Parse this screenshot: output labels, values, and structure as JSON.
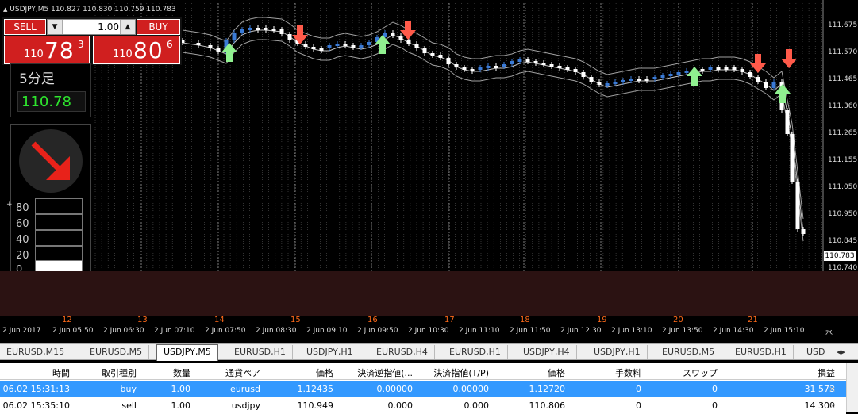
{
  "chart": {
    "header": "USDJPY,M5  110.827 110.830 110.759 110.783",
    "current_price": "110.783",
    "price_ticks": [
      "111.675",
      "111.570",
      "111.465",
      "111.360",
      "111.265",
      "111.155",
      "111.050",
      "110.950",
      "110.845",
      "110.740"
    ],
    "hour_labels": [
      "12",
      "13",
      "14",
      "15",
      "16",
      "17",
      "18",
      "19",
      "20",
      "21"
    ],
    "time_labels": [
      "2 Jun 2017",
      "2 Jun 05:50",
      "2 Jun 06:30",
      "2 Jun 07:10",
      "2 Jun 07:50",
      "2 Jun 08:30",
      "2 Jun 09:10",
      "2 Jun 09:50",
      "2 Jun 10:30",
      "2 Jun 11:10",
      "2 Jun 11:50",
      "2 Jun 12:30",
      "2 Jun 13:10",
      "2 Jun 13:50",
      "2 Jun 14:30",
      "2 Jun 15:10"
    ],
    "axis_corner": "水",
    "colors": {
      "bull": "#3a7ad6",
      "bear": "#ffffff",
      "up_arrow": "#8ff08f",
      "down_arrow": "#ff5a4a"
    }
  },
  "trade_panel": {
    "sell_label": "SELL",
    "buy_label": "BUY",
    "lot": "1.00",
    "sell_prefix": "110",
    "sell_big": "78",
    "sell_sup": "3",
    "buy_prefix": "110",
    "buy_big": "80",
    "buy_sup": "6"
  },
  "timeframe": {
    "label": "5分足",
    "price": "110.78"
  },
  "gauge": {
    "levels": [
      "80",
      "60",
      "40",
      "20",
      "0"
    ],
    "marker": "+",
    "fill_fraction": 0.15
  },
  "tabs": [
    {
      "label": "EURUSD,M15"
    },
    {
      "label": "EURUSD,M5"
    },
    {
      "label": "USDJPY,M5",
      "active": true
    },
    {
      "label": "EURUSD,H1"
    },
    {
      "label": "USDJPY,H1"
    },
    {
      "label": "EURUSD,H4"
    },
    {
      "label": "EURUSD,H1"
    },
    {
      "label": "USDJPY,H4"
    },
    {
      "label": "USDJPY,H1"
    },
    {
      "label": "EURUSD,M5"
    },
    {
      "label": "EURUSD,H1"
    },
    {
      "label": "USD"
    }
  ],
  "tab_scroll": "◂▸",
  "table": {
    "columns": [
      "時間",
      "取引種別",
      "数量",
      "通貨ペア",
      "価格",
      "決済逆指値(...",
      "決済指値(T/P)",
      "価格",
      "手数料",
      "スワップ",
      "損益"
    ],
    "sort_mark": "/",
    "rows": [
      [
        "06.02 15:31:13",
        "buy",
        "1.00",
        "eurusd",
        "1.12435",
        "0.00000",
        "0.00000",
        "1.12720",
        "0",
        "0",
        "31 573"
      ],
      [
        "06.02 15:35:10",
        "sell",
        "1.00",
        "usdjpy",
        "110.949",
        "0.000",
        "0.000",
        "110.806",
        "0",
        "0",
        "14 300"
      ]
    ],
    "close_mark": "×"
  }
}
